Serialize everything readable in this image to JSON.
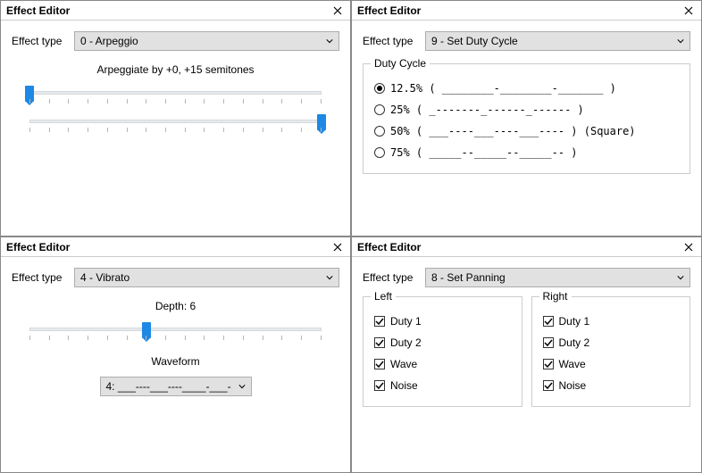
{
  "common": {
    "window_title": "Effect Editor",
    "effect_type_label": "Effect type"
  },
  "panel1": {
    "effect_type_value": "0 - Arpeggio",
    "desc": "Arpeggiate by +0, +15 semitones",
    "slider1_pos_pct": 0,
    "slider2_pos_pct": 100
  },
  "panel2": {
    "effect_type_value": "9 - Set Duty Cycle",
    "group_label": "Duty Cycle",
    "options": [
      {
        "label": "12.5% ( ________-________-_______ )",
        "checked": true
      },
      {
        "label": "25%   ( _-------_------_------ )",
        "checked": false
      },
      {
        "label": "50%   ( ___----___----___---- ) (Square)",
        "checked": false
      },
      {
        "label": "75%   ( _____--_____--_____-- )",
        "checked": false
      }
    ]
  },
  "panel3": {
    "effect_type_value": "4 - Vibrato",
    "depth_label": "Depth: 6",
    "slider_pos_pct": 40,
    "waveform_label": "Waveform",
    "waveform_value": "4: ___----___----____-___-"
  },
  "panel4": {
    "effect_type_value": "8 - Set Panning",
    "left_label": "Left",
    "right_label": "Right",
    "channels": [
      "Duty 1",
      "Duty 2",
      "Wave",
      "Noise"
    ],
    "left_checked": [
      true,
      true,
      true,
      true
    ],
    "right_checked": [
      true,
      true,
      true,
      true
    ]
  }
}
